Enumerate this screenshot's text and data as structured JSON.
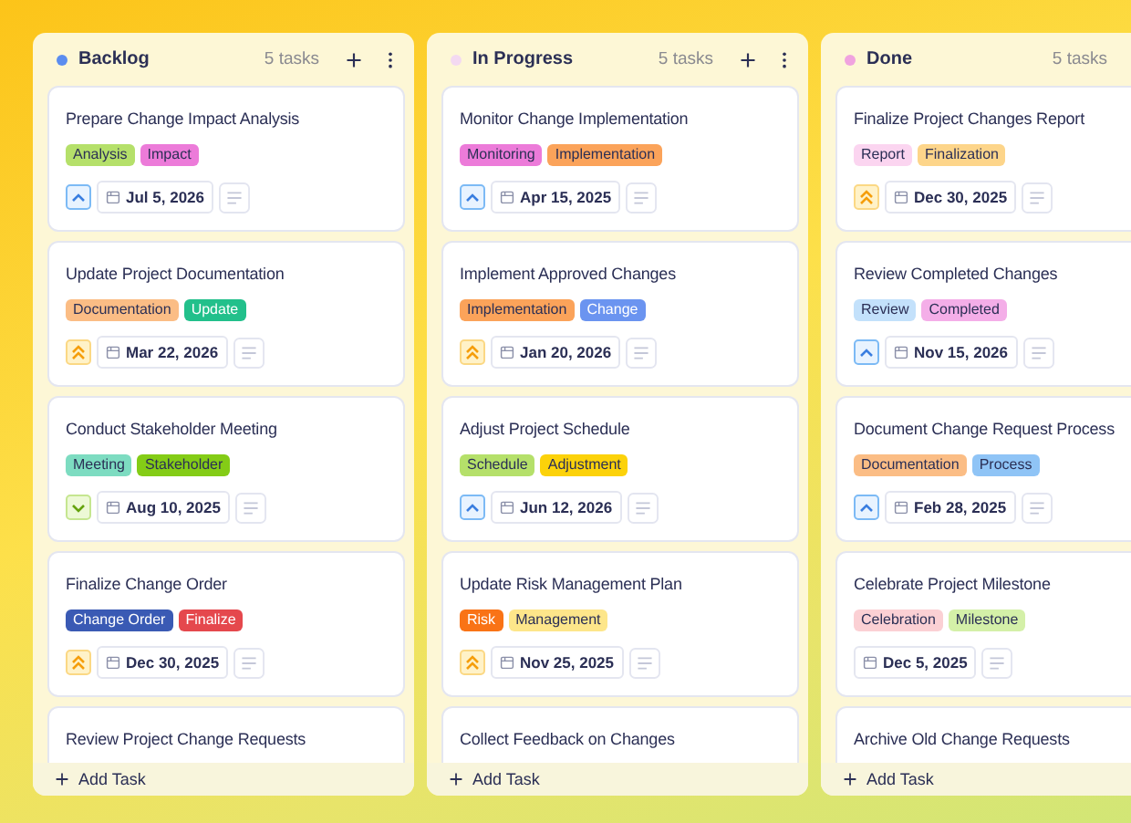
{
  "columns": [
    {
      "name": "Backlog",
      "color": "#5b8def",
      "count": "5 tasks",
      "add_label": "Add Task",
      "cards": [
        {
          "title": "Prepare Change Impact Analysis",
          "tags": [
            {
              "label": "Analysis",
              "color": "#b5e06a"
            },
            {
              "label": "Impact",
              "color": "#ec7bd9"
            }
          ],
          "kind": "medium",
          "date": "Jul 5, 2026"
        },
        {
          "title": "Update Project Documentation",
          "tags": [
            {
              "label": "Documentation",
              "color": "#fbbd85"
            },
            {
              "label": "Update",
              "color": "#22c08b"
            }
          ],
          "kind": "high",
          "date": "Mar 22, 2026"
        },
        {
          "title": "Conduct Stakeholder Meeting",
          "tags": [
            {
              "label": "Meeting",
              "color": "#7ddcc1"
            },
            {
              "label": "Stakeholder",
              "color": "#84cc16"
            }
          ],
          "kind": "low",
          "date": "Aug 10, 2025"
        },
        {
          "title": "Finalize Change Order",
          "tags": [
            {
              "label": "Change Order",
              "color": "#3a5ab4"
            },
            {
              "label": "Finalize",
              "color": "#e5484d"
            }
          ],
          "kind": "high",
          "date": "Dec 30, 2025"
        },
        {
          "title": "Review Project Change Requests"
        }
      ]
    },
    {
      "name": "In Progress",
      "color": "#f3d9f1",
      "count": "5 tasks",
      "add_label": "Add Task",
      "cards": [
        {
          "title": "Monitor Change Implementation",
          "tags": [
            {
              "label": "Monitoring",
              "color": "#ec7bd9"
            },
            {
              "label": "Implementation",
              "color": "#fba35a"
            }
          ],
          "kind": "medium",
          "date": "Apr 15, 2025"
        },
        {
          "title": "Implement Approved Changes",
          "tags": [
            {
              "label": "Implementation",
              "color": "#fba35a"
            },
            {
              "label": "Change",
              "color": "#6b94f0"
            }
          ],
          "kind": "high",
          "date": "Jan 20, 2026"
        },
        {
          "title": "Adjust Project Schedule",
          "tags": [
            {
              "label": "Schedule",
              "color": "#b5e06a"
            },
            {
              "label": "Adjustment",
              "color": "#fcd20a"
            }
          ],
          "kind": "medium",
          "date": "Jun 12, 2026"
        },
        {
          "title": "Update Risk Management Plan",
          "tags": [
            {
              "label": "Risk",
              "color": "#f97316"
            },
            {
              "label": "Management",
              "color": "#fde68a"
            }
          ],
          "kind": "high",
          "date": "Nov 25, 2025"
        },
        {
          "title": "Collect Feedback on Changes"
        }
      ]
    },
    {
      "name": "Done",
      "color": "#f0a3df",
      "count": "5 tasks",
      "add_label": "Add Task",
      "cards": [
        {
          "title": "Finalize Project Changes Report",
          "tags": [
            {
              "label": "Report",
              "color": "#fbd5f0"
            },
            {
              "label": "Finalization",
              "color": "#fdd58a"
            }
          ],
          "kind": "high",
          "date": "Dec 30, 2025"
        },
        {
          "title": "Review Completed Changes",
          "tags": [
            {
              "label": "Review",
              "color": "#c3e1fb"
            },
            {
              "label": "Completed",
              "color": "#f4aee8"
            }
          ],
          "kind": "medium",
          "date": "Nov 15, 2026"
        },
        {
          "title": "Document Change Request Process",
          "tags": [
            {
              "label": "Documentation",
              "color": "#fbbd85"
            },
            {
              "label": "Process",
              "color": "#8fc4f6"
            }
          ],
          "kind": "medium",
          "date": "Feb 28, 2025"
        },
        {
          "title": "Celebrate Project Milestone",
          "tags": [
            {
              "label": "Celebration",
              "color": "#fbd0d4"
            },
            {
              "label": "Milestone",
              "color": "#d4f0a8"
            }
          ],
          "kind": "plain",
          "date": "Dec 5, 2025"
        },
        {
          "title": "Archive Old Change Requests"
        }
      ]
    }
  ]
}
